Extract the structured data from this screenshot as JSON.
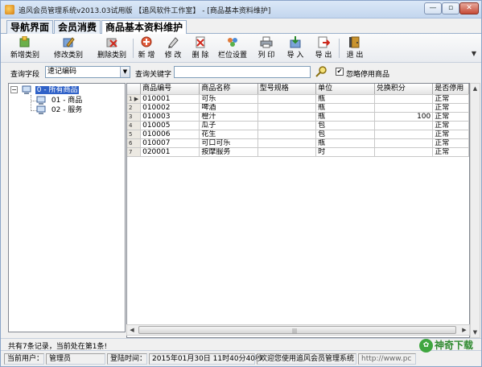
{
  "window": {
    "title": "追风会员管理系统v2013.03试用版 【追风软件工作室】 - [商品基本资料维护]",
    "min_glyph": "—",
    "max_glyph": "▫",
    "close_glyph": "✕"
  },
  "tabs": [
    {
      "label": "导航界面"
    },
    {
      "label": "会员消费"
    },
    {
      "label": "商品基本资料维护"
    }
  ],
  "toolbar": {
    "add_category": "新增类别",
    "edit_category": "修改类别",
    "delete_category": "删除类别",
    "add": "新 增",
    "edit": "修 改",
    "delete": "删 除",
    "column_settings": "栏位设置",
    "print": "列 印",
    "import": "导 入",
    "export": "导 出",
    "exit": "退 出",
    "more_glyph": "▼"
  },
  "search": {
    "field_label": "查询字段",
    "field_value": "速记编码",
    "keyword_label": "查询关键字",
    "keyword_value": "",
    "ignore_disabled_label": "忽略停用商品",
    "ignore_disabled_checked": "✔"
  },
  "tree": {
    "root": {
      "expand": "−",
      "label": "0 - 所有商品"
    },
    "children": [
      {
        "label": "01 - 商品"
      },
      {
        "label": "02 - 服务"
      }
    ]
  },
  "grid": {
    "columns": [
      "商品编号",
      "商品名称",
      "型号规格",
      "单位",
      "兑换积分",
      "是否停用"
    ],
    "current_marker": "▶",
    "rows": [
      {
        "n": "1",
        "code": "010001",
        "name": "可乐",
        "spec": "",
        "unit": "瓶",
        "points": "",
        "status": "正常"
      },
      {
        "n": "2",
        "code": "010002",
        "name": "啤酒",
        "spec": "",
        "unit": "瓶",
        "points": "",
        "status": "正常"
      },
      {
        "n": "3",
        "code": "010003",
        "name": "橙汁",
        "spec": "",
        "unit": "瓶",
        "points": "100",
        "status": "正常"
      },
      {
        "n": "4",
        "code": "010005",
        "name": "瓜子",
        "spec": "",
        "unit": "包",
        "points": "",
        "status": "正常"
      },
      {
        "n": "5",
        "code": "010006",
        "name": "花生",
        "spec": "",
        "unit": "包",
        "points": "",
        "status": "正常"
      },
      {
        "n": "6",
        "code": "010007",
        "name": "可口可乐",
        "spec": "",
        "unit": "瓶",
        "points": "",
        "status": "正常"
      },
      {
        "n": "7",
        "code": "020001",
        "name": "按摩服务",
        "spec": "",
        "unit": "时",
        "points": "",
        "status": "正常"
      }
    ]
  },
  "record_status": "共有7条记录，当前处在第1条!",
  "statusbar": {
    "user_label": "当前用户：",
    "user_value": "管理员",
    "login_label": "登陆时间：",
    "login_value": "2015年01月30日  11时40分40秒",
    "welcome": "欢迎您使用追风会员管理系统",
    "url": "http://www.pc"
  },
  "watermark": {
    "logo": "✿",
    "text": "神奇下载"
  }
}
